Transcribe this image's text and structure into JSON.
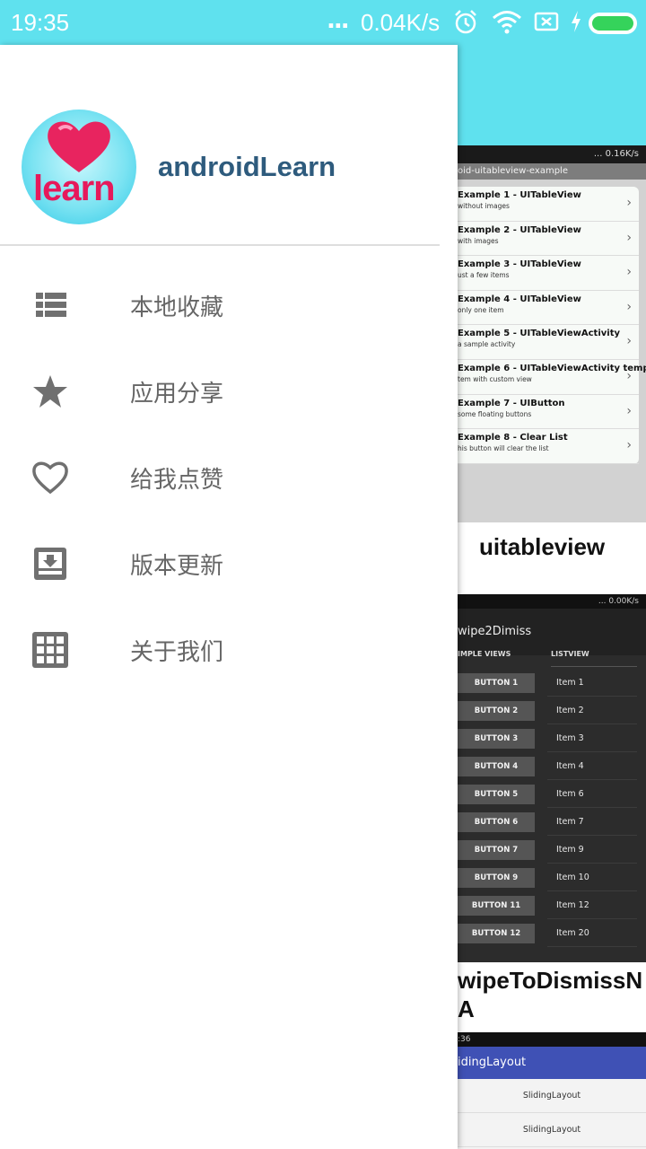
{
  "status_bar": {
    "time": "19:35",
    "dots": "...",
    "net_speed": "0.04K/s",
    "icons": [
      "alarm-icon",
      "wifi-icon",
      "sim-off-icon",
      "charging-icon",
      "battery-icon"
    ],
    "battery_color": "#35d35b"
  },
  "drawer": {
    "app_name": "androidLearn",
    "avatar_text": "learn",
    "menu": [
      {
        "icon": "list-icon",
        "label": "本地收藏"
      },
      {
        "icon": "star-icon",
        "label": "应用分享"
      },
      {
        "icon": "heart-outline-icon",
        "label": "给我点赞"
      },
      {
        "icon": "download-box-icon",
        "label": "版本更新"
      },
      {
        "icon": "grid-icon",
        "label": "关于我们"
      }
    ]
  },
  "cards": [
    {
      "title": "uitableview",
      "preview": {
        "status": "... 0.16K/s",
        "toolbar": "oid-uitableview-example",
        "rows": [
          {
            "title": "Example 1 - UITableView",
            "sub": "without images"
          },
          {
            "title": "Example 2 - UITableView",
            "sub": "with images"
          },
          {
            "title": "Example 3 - UITableView",
            "sub": "ust a few items"
          },
          {
            "title": "Example 4 - UITableView",
            "sub": "only one item"
          },
          {
            "title": "Example 5 - UITableViewActivity",
            "sub": "a sample activity"
          },
          {
            "title": "Example 6 - UITableViewActivity temp",
            "sub": "tem with custom view"
          },
          {
            "title": "Example 7 - UIButton",
            "sub": "some floating buttons"
          },
          {
            "title": "Example 8 - Clear List",
            "sub": "his button will clear the list"
          }
        ]
      }
    },
    {
      "title": "wipeToDismissNA",
      "preview": {
        "status": "... 0.00K/s",
        "toolbar": "wipe2Dimiss",
        "left_header": "IMPLE VIEWS",
        "right_header": "LISTVIEW",
        "buttons": [
          "BUTTON 1",
          "BUTTON 2",
          "BUTTON 3",
          "BUTTON 4",
          "BUTTON 5",
          "BUTTON 6",
          "BUTTON 7",
          "BUTTON 9",
          "BUTTON 11",
          "BUTTON 12"
        ],
        "items": [
          "Item 1",
          "Item 2",
          "Item 3",
          "Item 4",
          "Item 6",
          "Item 7",
          "Item 9",
          "Item 10",
          "Item 12",
          "Item 20"
        ]
      }
    },
    {
      "title": "",
      "preview": {
        "status": ":36",
        "toolbar": "idingLayout",
        "rows": [
          "SlidingLayout",
          "SlidingLayout"
        ]
      }
    }
  ]
}
